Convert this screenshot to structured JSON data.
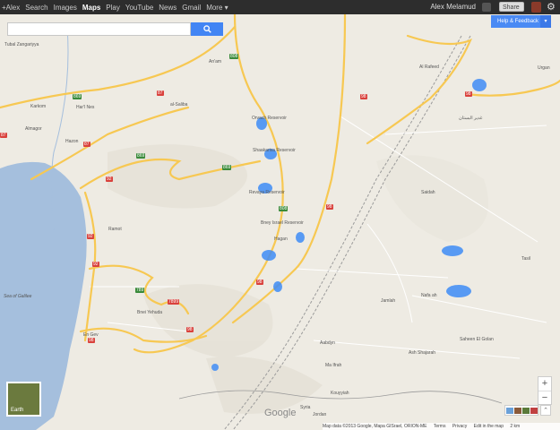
{
  "topbar": {
    "nav": [
      "+Alex",
      "Search",
      "Images",
      "Maps",
      "Play",
      "YouTube",
      "News",
      "Gmail",
      "More ▾"
    ],
    "active": "Maps",
    "user_name": "Alex Melamud",
    "share_label": "Share"
  },
  "search": {
    "placeholder": ""
  },
  "help": {
    "label": "Help & Feedback"
  },
  "zoom": {
    "in": "+",
    "out": "−"
  },
  "earth": {
    "label": "Earth"
  },
  "logo": "Google",
  "footer": [
    "Map data ©2013 Google, Mapa GISrael, ORION-ME",
    "Terms",
    "Privacy",
    "Edit in the map",
    "2 km"
  ],
  "places": [
    "Tubal Zangariyya",
    "Karkom",
    "Almagor",
    "Hazon",
    "Har'l Nes",
    "An'am",
    "al-Saliba",
    "Orvach Reservoir",
    "Shaakariva Reservoir",
    "Revaya Reservoir",
    "Bney Israel Reservoir",
    "Hagan",
    "Ramot",
    "Sea of Galilee",
    "Bnei Yehuda",
    "En Gev",
    "Al Rafeed",
    "Urgan",
    "غدير البستان",
    "Saidah",
    "Tasil",
    "Nafa ah",
    "Jamlah",
    "Saheen El Golan",
    "Aabdyn",
    "Ash Shajarah",
    "Ma Ifrah",
    "Kouyyiah",
    "Syria",
    "Jordan"
  ],
  "road_numbers": [
    "87",
    "87",
    "87",
    "92",
    "92",
    "92",
    "808",
    "869",
    "869",
    "808",
    "98",
    "98",
    "98",
    "98",
    "98",
    "789",
    "7899",
    "98",
    "869"
  ],
  "colors": {
    "map_bg": "#eeebe3",
    "water": "#a5bfdd",
    "lake": "#3f8cf6",
    "road_major": "#f7c852",
    "road_minor": "#ffffff",
    "topbar": "#2d2d2d",
    "accent": "#4285f4"
  }
}
